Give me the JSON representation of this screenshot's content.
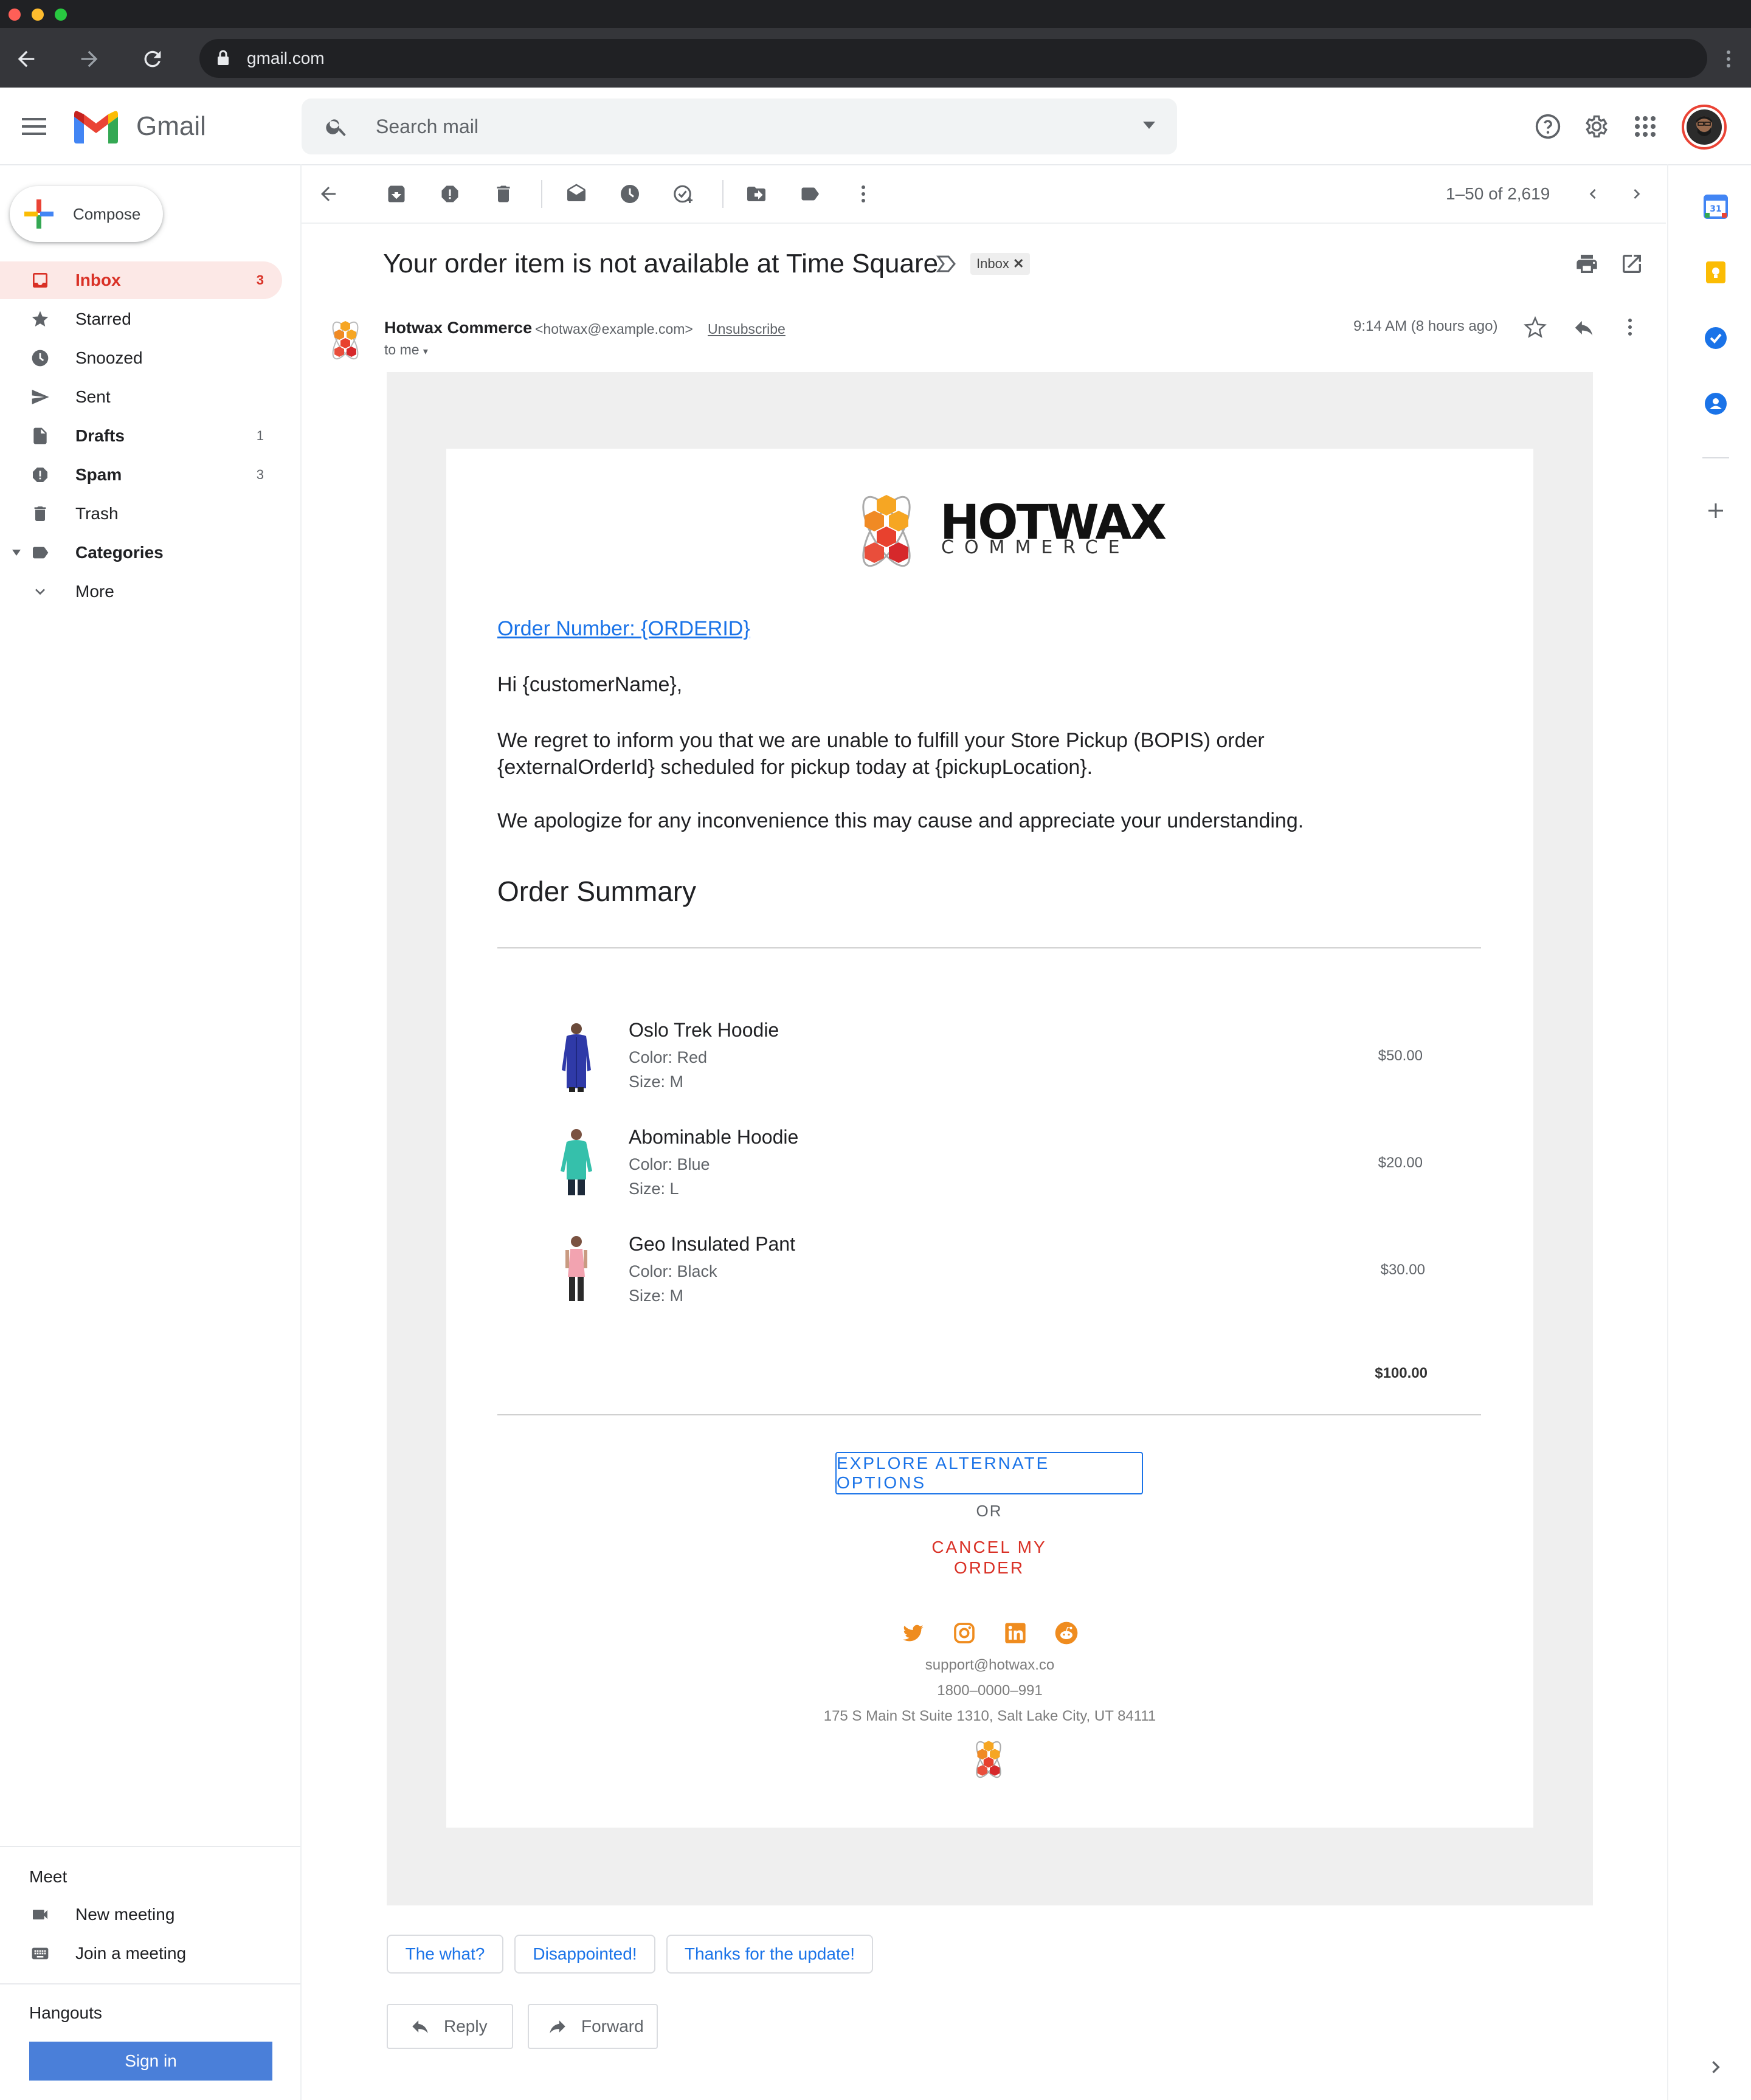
{
  "browser": {
    "url": "gmail.com"
  },
  "header": {
    "app_name": "Gmail",
    "search_placeholder": "Search mail"
  },
  "sidebar": {
    "compose_label": "Compose",
    "items": [
      {
        "label": "Inbox",
        "count": "3",
        "icon": "inbox-icon"
      },
      {
        "label": "Starred",
        "count": "",
        "icon": "star-icon"
      },
      {
        "label": "Snoozed",
        "count": "",
        "icon": "clock-icon"
      },
      {
        "label": "Sent",
        "count": "",
        "icon": "send-icon"
      },
      {
        "label": "Drafts",
        "count": "1",
        "icon": "draft-icon"
      },
      {
        "label": "Spam",
        "count": "3",
        "icon": "spam-icon"
      },
      {
        "label": "Trash",
        "count": "",
        "icon": "trash-icon"
      },
      {
        "label": "Categories",
        "count": "",
        "icon": "label-icon"
      },
      {
        "label": "More",
        "count": "",
        "icon": "chevron-down-icon"
      }
    ],
    "meet": {
      "title": "Meet",
      "new_meeting": "New meeting",
      "join_meeting": "Join a meeting"
    },
    "hangouts": {
      "title": "Hangouts",
      "sign_in": "Sign in"
    }
  },
  "toolbar": {
    "pager": "1–50 of 2,619"
  },
  "message": {
    "subject": "Your order item is not available at Time Square",
    "label_chip": "Inbox",
    "sender_name": "Hotwax Commerce",
    "sender_email": "<hotwax@example.com>",
    "unsubscribe": "Unsubscribe",
    "recipient": "to me",
    "time": "9:14 AM (8 hours ago)"
  },
  "email": {
    "logo_word": "HOTWAX",
    "logo_sub": "COMMERCE",
    "order_number": "Order Number: {ORDERID}",
    "greeting": "Hi {customerName},",
    "para1_line1": "We regret to inform you that we are unable to fulfill your Store Pickup (BOPIS) order",
    "para1_line2": "{externalOrderId} scheduled for pickup today at {pickupLocation}.",
    "para2": "We apologize for any inconvenience this may cause and appreciate your understanding.",
    "summary_title": "Order Summary",
    "items": [
      {
        "name": "Oslo Trek Hoodie",
        "color": "Color: Red",
        "size": "Size: M",
        "price": "$50.00"
      },
      {
        "name": "Abominable Hoodie",
        "color": "Color: Blue",
        "size": "Size: L",
        "price": "$20.00"
      },
      {
        "name": "Geo Insulated Pant",
        "color": "Color: Black",
        "size": "Size: M",
        "price": "$30.00"
      }
    ],
    "total": "$100.00",
    "explore_button": "EXPLORE ALTERNATE OPTIONS",
    "or_text": "OR",
    "cancel_link": "CANCEL MY ORDER",
    "footer": {
      "email": "support@hotwax.co",
      "phone": "1800–0000–991",
      "address": "175 S Main St Suite 1310, Salt Lake City, UT 84111"
    },
    "colors": {
      "brand_orange": "#ef8c1f",
      "link_blue": "#1a73e8",
      "cancel_red": "#d93025"
    }
  },
  "smart_replies": [
    "The what?",
    "Disappointed!",
    "Thanks for the update!"
  ],
  "actions": {
    "reply": "Reply",
    "forward": "Forward"
  }
}
